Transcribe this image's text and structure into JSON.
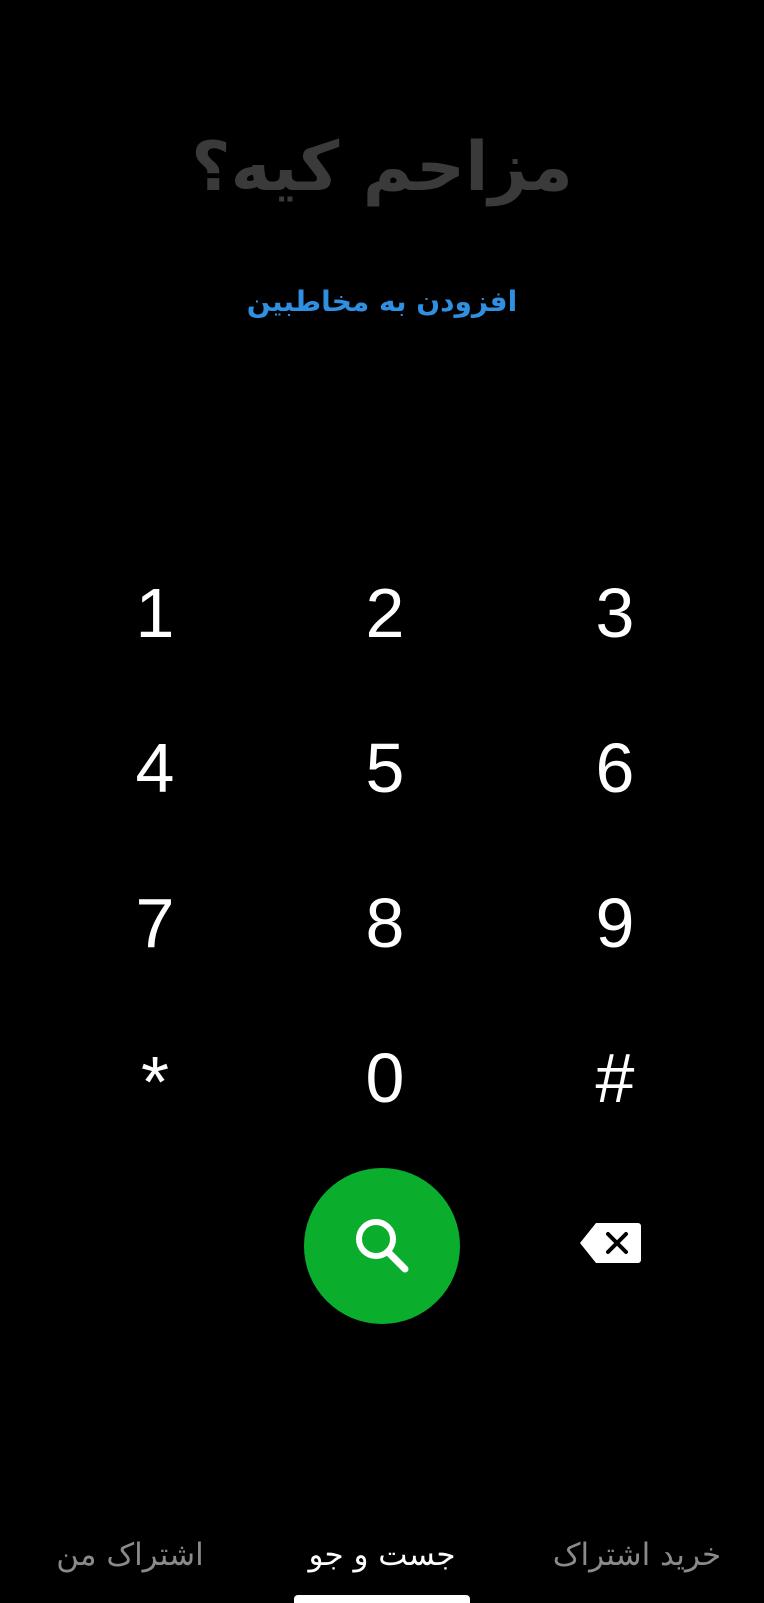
{
  "header": {
    "title": "مزاحم کیه؟",
    "add_contact_label": "افزودن به مخاطبین"
  },
  "keypad": {
    "keys": [
      "1",
      "2",
      "3",
      "4",
      "5",
      "6",
      "7",
      "8",
      "9",
      "*",
      "0",
      "#"
    ]
  },
  "actions": {
    "search_icon": "search-icon",
    "backspace_icon": "backspace-icon"
  },
  "bottom_nav": {
    "items": [
      {
        "label": "اشتراک من",
        "active": false
      },
      {
        "label": "جست و جو",
        "active": true
      },
      {
        "label": "خرید اشتراک",
        "active": false
      }
    ]
  },
  "colors": {
    "background": "#000000",
    "title": "#3a3a3a",
    "link": "#2f8fe0",
    "search_button": "#0aad2c",
    "inactive_nav": "#8a8a8a"
  }
}
